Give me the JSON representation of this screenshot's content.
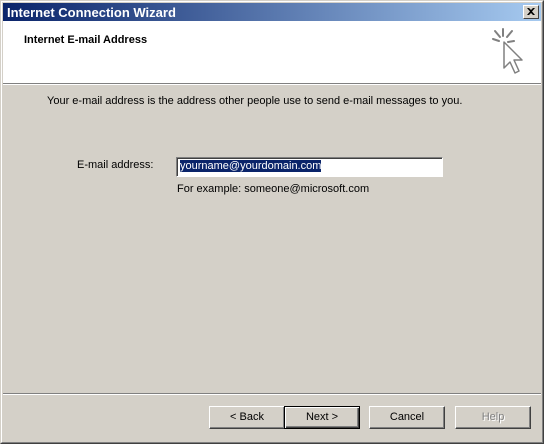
{
  "window": {
    "title": "Internet Connection Wizard",
    "close_icon": "close-icon"
  },
  "header": {
    "title": "Internet E-mail Address",
    "icon": "wizard-cursor-icon"
  },
  "body": {
    "description": "Your e-mail address is the address other people use to send e-mail messages to you.",
    "email_label": "E-mail address:",
    "email_value": "yourname@yourdomain.com",
    "example": "For example: someone@microsoft.com"
  },
  "buttons": {
    "back": "< Back",
    "next": "Next >",
    "cancel": "Cancel",
    "help": "Help"
  },
  "colors": {
    "titlebar_start": "#0a246a",
    "titlebar_end": "#a6caf0",
    "face": "#d4d0c8",
    "selection": "#0a246a"
  }
}
